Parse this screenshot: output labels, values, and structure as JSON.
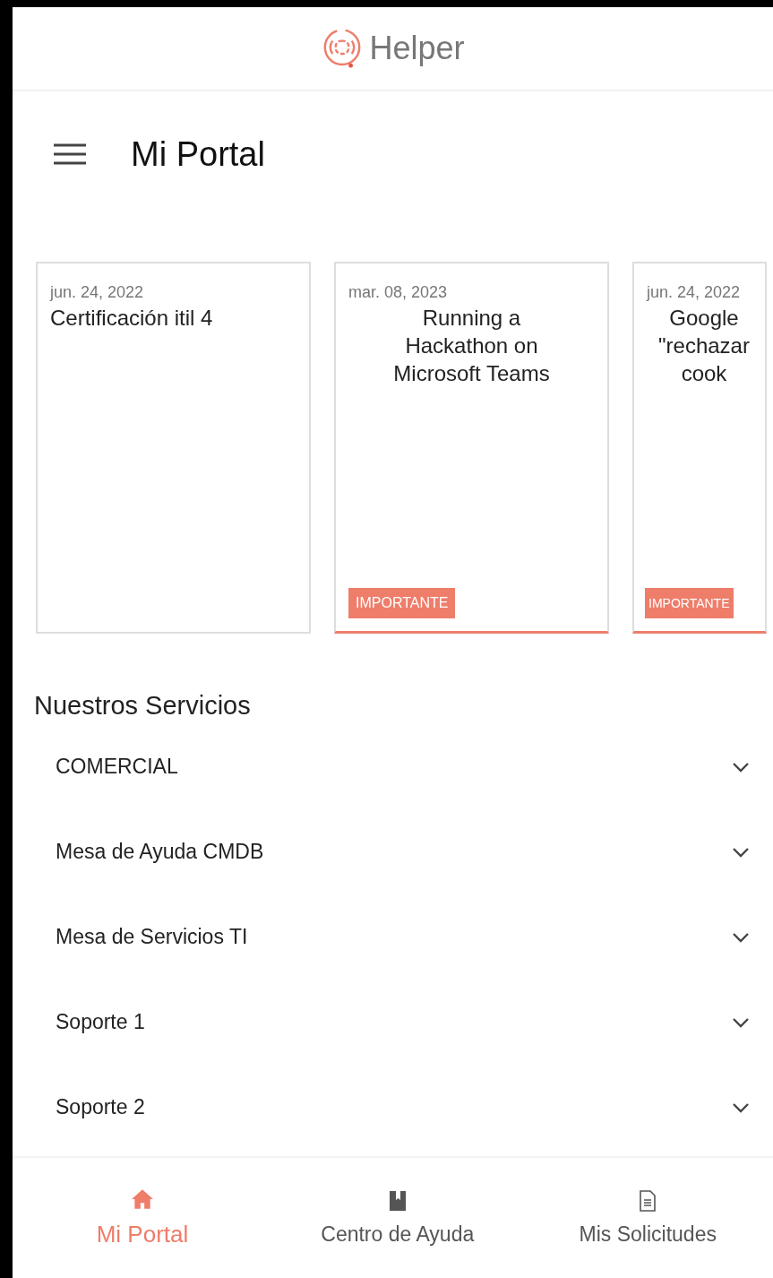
{
  "app_bar": {
    "brand": "Helper"
  },
  "page": {
    "title": "Mi Portal"
  },
  "news_cards": [
    {
      "date": "jun. 24, 2022",
      "title": "Certificación itil 4",
      "important": false
    },
    {
      "date": "mar. 08, 2023",
      "title": "Running a Hackathon on Microsoft Teams",
      "important": true,
      "tag": "IMPORTANTE"
    },
    {
      "date": "jun. 24, 2022",
      "title": "Google \"rechazar cook",
      "important": true,
      "tag": "IMPORTANTE"
    }
  ],
  "services": {
    "heading": "Nuestros Servicios",
    "items": [
      {
        "label": "COMERCIAL",
        "expanded": false
      },
      {
        "label": "Mesa de Ayuda CMDB",
        "expanded": false
      },
      {
        "label": "Mesa de Servicios TI",
        "expanded": false
      },
      {
        "label": "Soporte 1",
        "expanded": false
      },
      {
        "label": "Soporte 2",
        "expanded": false
      }
    ]
  },
  "bottom_nav": [
    {
      "kind": "home",
      "label": "Mi Portal",
      "selected": true
    },
    {
      "kind": "book",
      "label": "Centro de Ayuda",
      "selected": false
    },
    {
      "kind": "document",
      "label": "Mis Solicitudes",
      "selected": false
    }
  ]
}
